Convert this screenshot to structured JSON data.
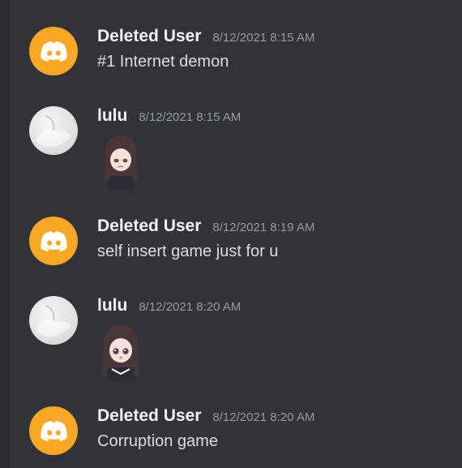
{
  "colors": {
    "background": "#313338",
    "discord_avatar": "#f9a825",
    "username": "#f2f3f5",
    "timestamp": "#949ba4",
    "message_text": "#dbdee1"
  },
  "messages": [
    {
      "avatar": "discord-logo-icon",
      "username": "Deleted User",
      "timestamp": "8/12/2021 8:15 AM",
      "text": "#1 Internet demon"
    },
    {
      "avatar": "lulu-avatar",
      "username": "lulu",
      "timestamp": "8/12/2021 8:15 AM",
      "sticker": "anime-girl-sticker"
    },
    {
      "avatar": "discord-logo-icon",
      "username": "Deleted User",
      "timestamp": "8/12/2021 8:19 AM",
      "text": "self insert game just for u"
    },
    {
      "avatar": "lulu-avatar",
      "username": "lulu",
      "timestamp": "8/12/2021 8:20 AM",
      "sticker": "anime-girl-sticker"
    },
    {
      "avatar": "discord-logo-icon",
      "username": "Deleted User",
      "timestamp": "8/12/2021 8:20 AM",
      "text": "Corruption game"
    }
  ]
}
